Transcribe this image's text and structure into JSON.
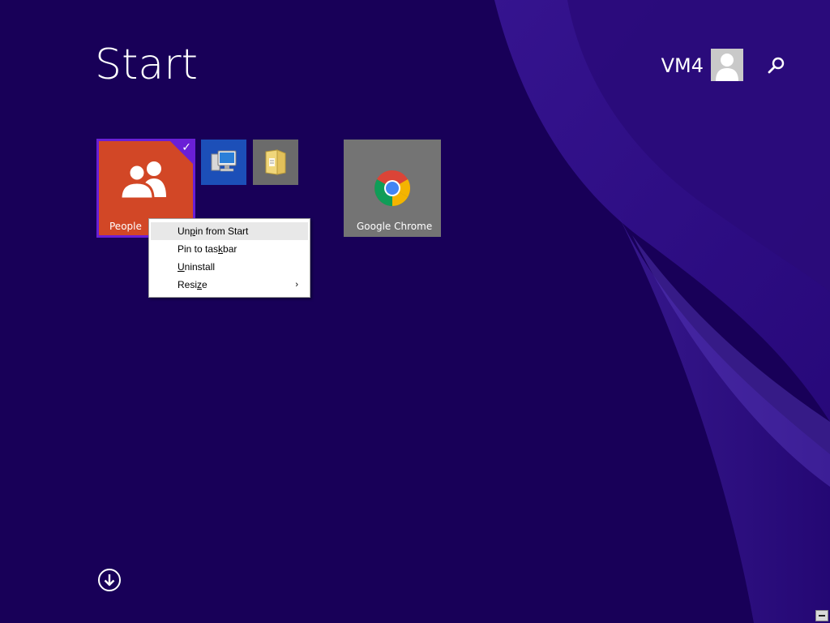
{
  "screen": {
    "title": "Start",
    "background_color": "#180058",
    "accent_color": "#6a1fd6"
  },
  "user": {
    "name": "VM4",
    "avatar_icon": "user-silhouette-icon"
  },
  "search": {
    "icon": "search-icon"
  },
  "tiles": [
    {
      "id": "people",
      "label": "People",
      "color": "#d24726",
      "icon": "people-icon",
      "selected": true
    },
    {
      "id": "computer",
      "label": "",
      "color": "#1c4fb8",
      "icon": "computer-icon",
      "selected": false
    },
    {
      "id": "file-explorer",
      "label": "",
      "color": "#6b6b6b",
      "icon": "folder-icon",
      "selected": false
    },
    {
      "id": "chrome",
      "label": "Google Chrome",
      "color": "#747474",
      "icon": "chrome-icon",
      "selected": false
    }
  ],
  "context_menu": {
    "items": [
      {
        "label_pre": "Un",
        "label_u": "p",
        "label_post": "in from Start",
        "highlighted": true,
        "has_submenu": false
      },
      {
        "label_pre": "Pin to tas",
        "label_u": "k",
        "label_post": "bar",
        "highlighted": false,
        "has_submenu": false
      },
      {
        "label_pre": "",
        "label_u": "U",
        "label_post": "ninstall",
        "highlighted": false,
        "has_submenu": false
      },
      {
        "label_pre": "Resi",
        "label_u": "z",
        "label_post": "e",
        "highlighted": false,
        "has_submenu": true
      }
    ],
    "submenu_arrow": "›"
  },
  "footer": {
    "all_apps_icon": "arrow-down-circle-icon"
  }
}
